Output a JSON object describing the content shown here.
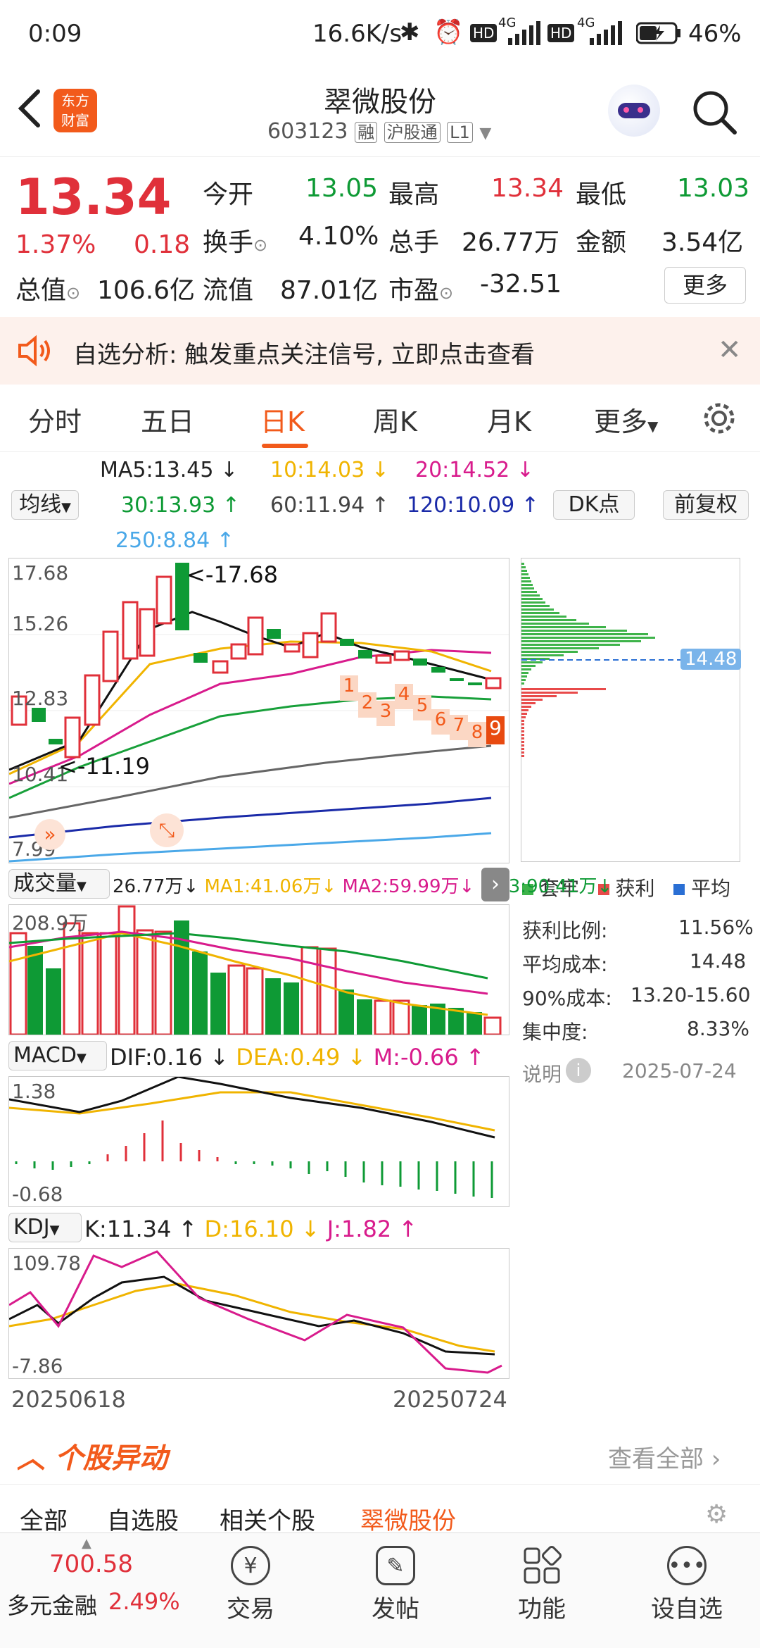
{
  "status_bar": {
    "time": "0:09",
    "speed": "16.6K/s",
    "net1": "4G",
    "net2": "4G",
    "battery": "46%"
  },
  "header": {
    "title": "翠微股份",
    "code": "603123",
    "tags": [
      "融",
      "沪股通",
      "L1"
    ],
    "brand": "东方财富"
  },
  "quote": {
    "price": "13.34",
    "change_pct": "1.37%",
    "change": "0.18",
    "open_label": "今开",
    "open": "13.05",
    "high_label": "最高",
    "high": "13.34",
    "low_label": "最低",
    "low": "13.03",
    "turnover_label": "换手",
    "turnover": "4.10%",
    "volume_label": "总手",
    "volume": "26.77万",
    "amount_label": "金额",
    "amount": "3.54亿",
    "mktcap_label": "总值",
    "mktcap": "106.6亿",
    "float_label": "流值",
    "float": "87.01亿",
    "pe_label": "市盈",
    "pe": "-32.51",
    "more": "更多"
  },
  "notice": {
    "text": "自选分析: 触发重点关注信号, 立即点击查看"
  },
  "tabs": [
    "分时",
    "五日",
    "日K",
    "周K",
    "月K",
    "更多"
  ],
  "active_tab": "日K",
  "ma": {
    "ma5": "MA5:13.45",
    "ma10": "10:14.03",
    "ma20": "20:14.52",
    "ma30": "30:13.93",
    "ma60": "60:11.94",
    "ma120": "120:10.09",
    "ma250": "250:8.84",
    "select": "均线",
    "dk": "DK点",
    "fq": "前复权"
  },
  "kline": {
    "ylabels": [
      "17.68",
      "15.26",
      "12.83",
      "10.41",
      "7.99"
    ],
    "high_note": "<-17.68",
    "low_note": "<-11.19",
    "countdown": [
      "1",
      "2",
      "3",
      "4",
      "5",
      "6",
      "7",
      "8",
      "9"
    ]
  },
  "chips": {
    "legend": [
      "套牢",
      "获利",
      "平均"
    ],
    "avg_price": "14.48",
    "profit_ratio_label": "获利比例:",
    "profit_ratio": "11.56%",
    "avg_cost_label": "平均成本:",
    "avg_cost": "14.48",
    "cost90_label": "90%成本:",
    "cost90": "13.20-15.60",
    "concentration_label": "集中度:",
    "concentration": "8.33%",
    "explain": "说明",
    "date": "2025-07-24"
  },
  "volume_row": {
    "select": "成交量",
    "vol": "26.77万",
    "ma1": "MA1:41.06万",
    "ma2": "MA2:59.99万",
    "ma3": "MA3:90.41万",
    "ymax": "208.9万"
  },
  "macd": {
    "select": "MACD",
    "dif": "DIF:0.16",
    "dea": "DEA:0.49",
    "m": "M:-0.66",
    "ymax": "1.38",
    "ymin": "-0.68"
  },
  "kdj": {
    "select": "KDJ",
    "k": "K:11.34",
    "d": "D:16.10",
    "j": "J:1.82",
    "ymax": "109.78",
    "ymin": "-7.86"
  },
  "dates": {
    "start": "20250618",
    "end": "20250724"
  },
  "movement": {
    "title": "个股异动",
    "view_all": "查看全部"
  },
  "sub_tabs": [
    "全部",
    "自选股",
    "相关个股",
    "翠微股份"
  ],
  "bottom": {
    "index_value": "700.58",
    "index_name": "多元金融",
    "index_pct": "2.49%",
    "nav": [
      "交易",
      "发帖",
      "功能",
      "设自选"
    ]
  },
  "colors": {
    "up": "#e0303a",
    "down": "#0e9a35",
    "accent": "#ff6a13",
    "ma10": "#f0b400",
    "ma20": "#d81b8c"
  }
}
